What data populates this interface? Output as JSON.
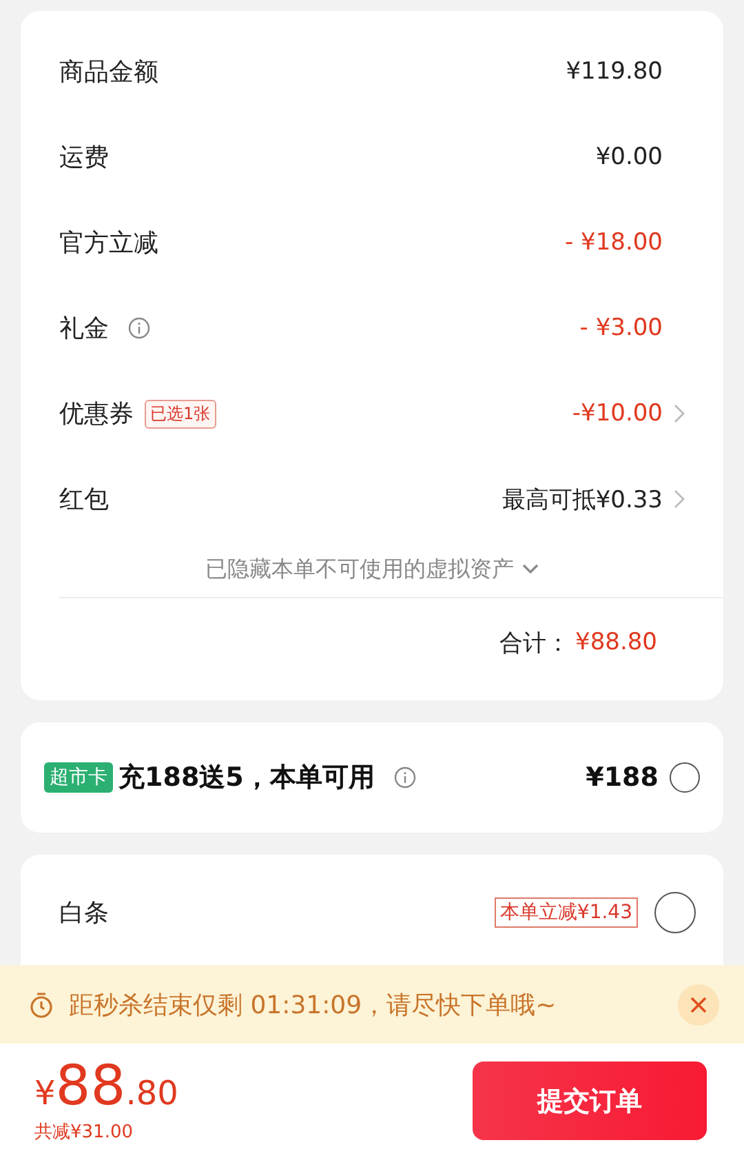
{
  "summary": {
    "rows": [
      {
        "label": "商品金额",
        "value": "¥119.80",
        "kind": "normal",
        "info": false,
        "arrow": false
      },
      {
        "label": "运费",
        "value": "¥0.00",
        "kind": "normal",
        "info": false,
        "arrow": false
      },
      {
        "label": "官方立减",
        "value": "- ¥18.00",
        "kind": "discount",
        "info": false,
        "arrow": false
      },
      {
        "label": "礼金",
        "value": "- ¥3.00",
        "kind": "discount",
        "info": true,
        "arrow": false
      },
      {
        "label": "优惠券",
        "tag": "已选1张",
        "value": "-¥10.00",
        "kind": "discount",
        "info": false,
        "arrow": true
      },
      {
        "label": "红包",
        "value": "最高可抵¥0.33",
        "kind": "normal",
        "info": false,
        "arrow": true
      }
    ],
    "hidden_note": "已隐藏本单不可使用的虚拟资产",
    "total_label": "合计：",
    "total_value": "¥88.80"
  },
  "card_offer": {
    "badge": "超市卡",
    "title": "充188送5，本单可用",
    "price": "¥188",
    "selected": false
  },
  "payment": {
    "label": "白条",
    "promo": "本单立减¥1.43",
    "selected": false
  },
  "banner": {
    "text": "距秒杀结束仅剩 01:31:09，请尽快下单哦~"
  },
  "footer": {
    "currency": "¥",
    "amount_int": "88",
    "amount_dec": ".80",
    "saved": "共减¥31.00",
    "submit": "提交订单"
  }
}
